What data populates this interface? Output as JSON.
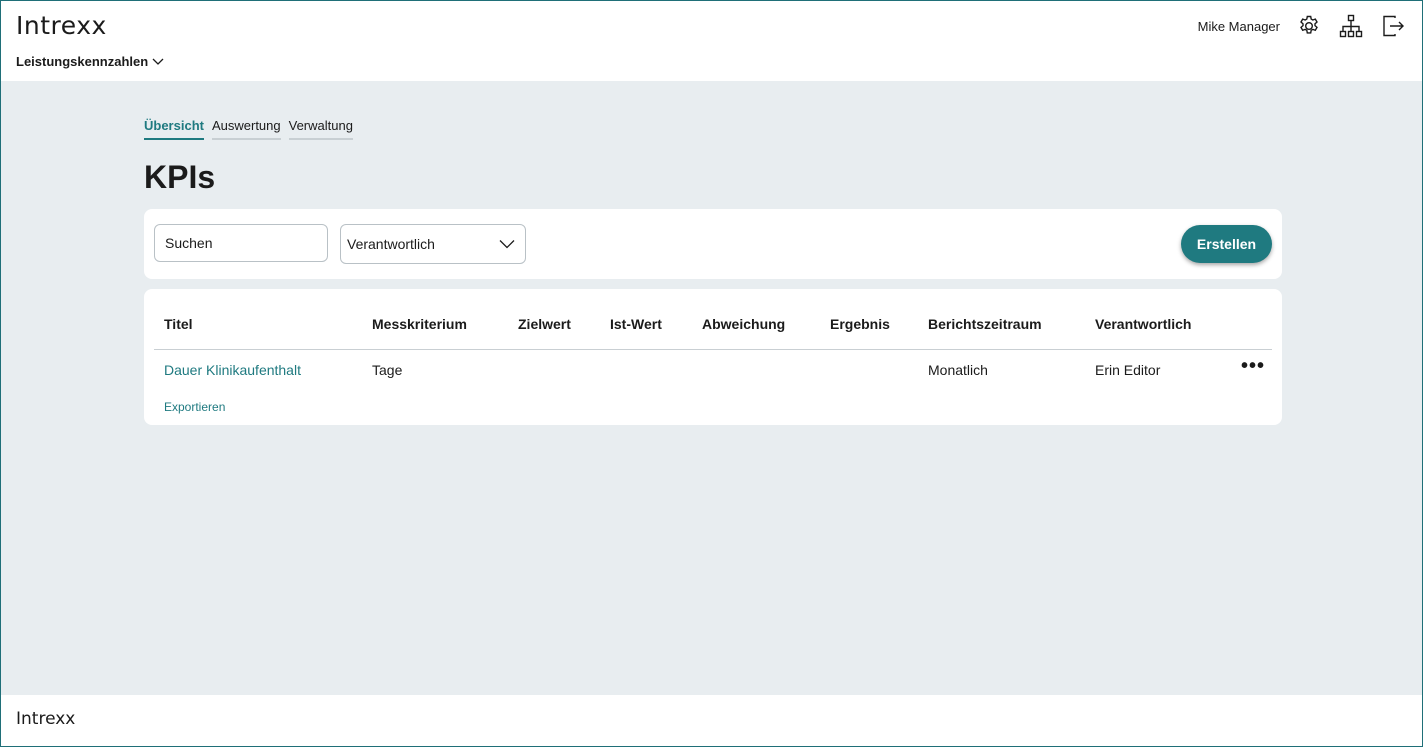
{
  "header": {
    "logo": "Intrexx",
    "app_menu_label": "Leistungskennzahlen",
    "user_name": "Mike Manager",
    "icons": [
      "gear-icon",
      "sitemap-icon",
      "logout-icon"
    ]
  },
  "tabs": [
    {
      "label": "Übersicht",
      "active": true
    },
    {
      "label": "Auswertung",
      "active": false
    },
    {
      "label": "Verwaltung",
      "active": false
    }
  ],
  "page_title": "KPIs",
  "filters": {
    "search_placeholder": "Suchen",
    "select_value": "Verantwortlich",
    "create_label": "Erstellen"
  },
  "table": {
    "columns": [
      "Titel",
      "Messkriterium",
      "Zielwert",
      "Ist-Wert",
      "Abweichung",
      "Ergebnis",
      "Berichtszeitraum",
      "Verantwortlich"
    ],
    "rows": [
      {
        "titel": "Dauer Klinikaufenthalt",
        "messkriterium": "Tage",
        "zielwert": "",
        "ist_wert": "",
        "abweichung": "",
        "ergebnis": "",
        "berichtszeitraum": "Monatlich",
        "verantwortlich": "Erin Editor"
      }
    ],
    "export_label": "Exportieren"
  },
  "footer": {
    "logo": "Intrexx"
  },
  "colors": {
    "accent": "#1f7a80",
    "background": "#e8edf0"
  }
}
